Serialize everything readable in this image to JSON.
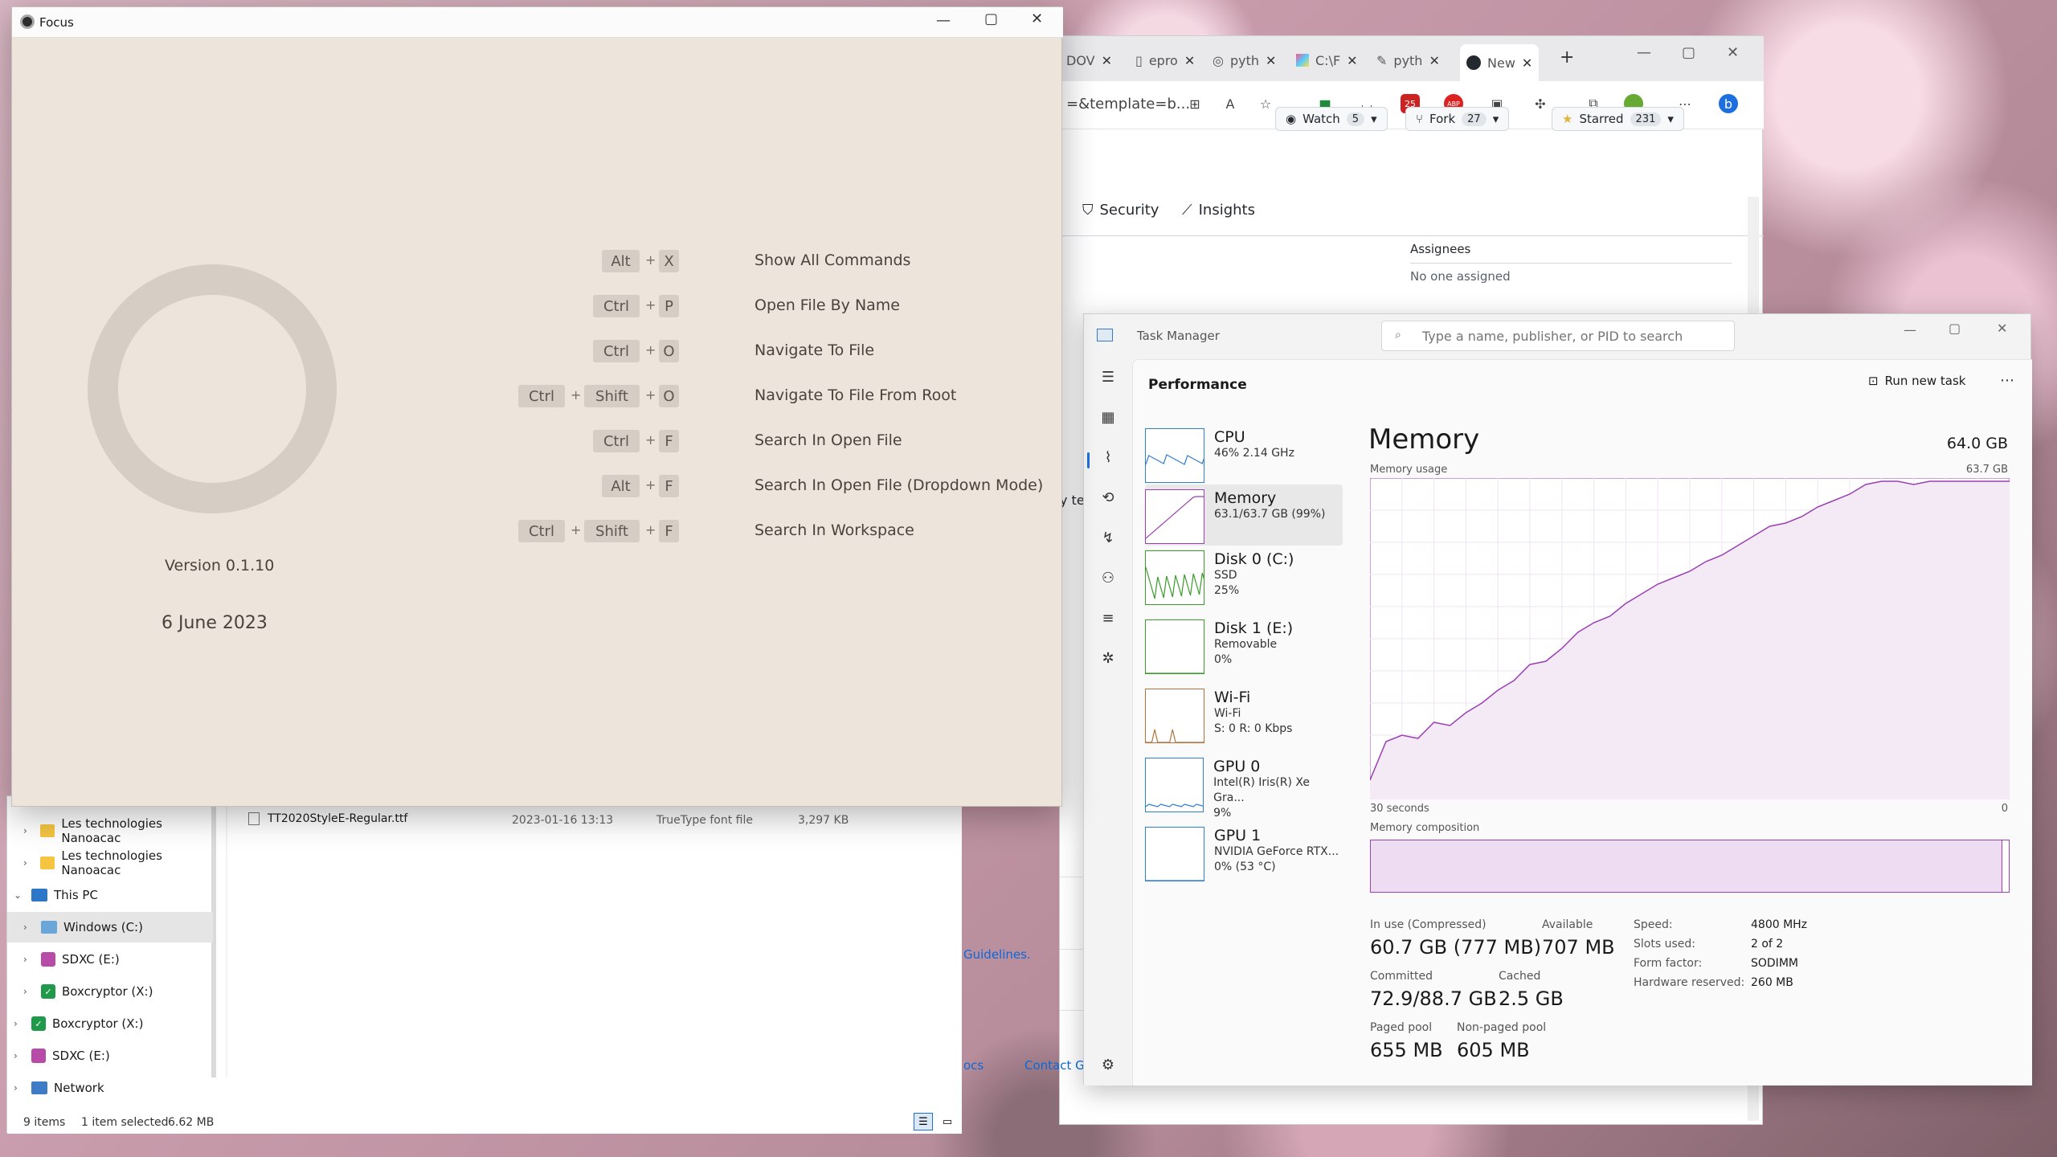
{
  "focus": {
    "title": "Focus",
    "version": "Version 0.1.10",
    "date": "6 June 2023",
    "commands": [
      {
        "keys": [
          "Alt",
          "X"
        ],
        "label": "Show All Commands"
      },
      {
        "keys": [
          "Ctrl",
          "P"
        ],
        "label": "Open File By Name"
      },
      {
        "keys": [
          "Ctrl",
          "O"
        ],
        "label": "Navigate To File"
      },
      {
        "keys": [
          "Ctrl",
          "Shift",
          "O"
        ],
        "label": "Navigate To File From Root"
      },
      {
        "keys": [
          "Ctrl",
          "F"
        ],
        "label": "Search In Open File"
      },
      {
        "keys": [
          "Alt",
          "F"
        ],
        "label": "Search In Open File (Dropdown Mode)"
      },
      {
        "keys": [
          "Ctrl",
          "Shift",
          "F"
        ],
        "label": "Search In Workspace"
      }
    ],
    "plus": "+"
  },
  "browser": {
    "tabs": [
      "DOV",
      "epro",
      "pyth",
      "C:\\F",
      "pyth",
      "New"
    ],
    "address": "=&template=b...",
    "repo_buttons": {
      "watch": "Watch",
      "watch_count": "5",
      "fork": "Fork",
      "fork_count": "27",
      "starred": "Starred",
      "starred_count": "231"
    },
    "nav": {
      "security": "Security",
      "insights": "Insights"
    },
    "assignees_label": "Assignees",
    "assignees_value": "No one assigned",
    "side_text": "y te:",
    "guidelines": "Guidelines.",
    "footer_docs": "ocs",
    "footer_contact": "Contact Git",
    "extension_badge": "25",
    "abp": "ABP"
  },
  "explorer": {
    "tree": [
      {
        "label": "Les technologies Nanoacac",
        "icon": "folder"
      },
      {
        "label": "Les technologies Nanoacac",
        "icon": "folder"
      },
      {
        "label": "This PC",
        "icon": "pc"
      },
      {
        "label": "Windows (C:)",
        "icon": "drive"
      },
      {
        "label": "SDXC (E:)",
        "icon": "sd"
      },
      {
        "label": "Boxcryptor (X:)",
        "icon": "green"
      },
      {
        "label": "Boxcryptor (X:)",
        "icon": "green"
      },
      {
        "label": "SDXC (E:)",
        "icon": "sd"
      },
      {
        "label": "Network",
        "icon": "network"
      }
    ],
    "file": {
      "name": "TT2020StyleE-Regular.ttf",
      "date": "2023-01-16 13:13",
      "type": "TrueType font file",
      "size": "3,297 KB"
    },
    "status": {
      "items": "9 items",
      "selected": "1 item selected",
      "size": "6.62 MB"
    }
  },
  "taskmgr": {
    "title": "Task Manager",
    "search_placeholder": "Type a name, publisher, or PID to search",
    "section": "Performance",
    "run_new_task": "Run new task",
    "list": [
      {
        "name": "CPU",
        "sub1": "46% 2.14 GHz",
        "sub2": "",
        "sub3": ""
      },
      {
        "name": "Memory",
        "sub1": "63.1/63.7 GB (99%)",
        "sub2": "",
        "sub3": ""
      },
      {
        "name": "Disk 0 (C:)",
        "sub1": "SSD",
        "sub2": "25%",
        "sub3": ""
      },
      {
        "name": "Disk 1 (E:)",
        "sub1": "Removable",
        "sub2": "0%",
        "sub3": ""
      },
      {
        "name": "Wi-Fi",
        "sub1": "Wi-Fi",
        "sub2": "S: 0 R: 0 Kbps",
        "sub3": ""
      },
      {
        "name": "GPU 0",
        "sub1": "Intel(R) Iris(R) Xe Gra...",
        "sub2": "9%",
        "sub3": ""
      },
      {
        "name": "GPU 1",
        "sub1": "NVIDIA GeForce RTX...",
        "sub2": "0% (53 °C)",
        "sub3": ""
      }
    ],
    "memory": {
      "heading": "Memory",
      "total": "64.0 GB",
      "usage_label": "Memory usage",
      "usage_max": "63.7 GB",
      "time_left": "30 seconds",
      "time_right": "0",
      "composition_label": "Memory composition",
      "in_use_label": "In use (Compressed)",
      "in_use": "60.7 GB (777 MB)",
      "available_label": "Available",
      "available": "707 MB",
      "committed_label": "Committed",
      "committed": "72.9/88.7 GB",
      "cached_label": "Cached",
      "cached": "2.5 GB",
      "paged_label": "Paged pool",
      "paged": "655 MB",
      "nonpaged_label": "Non-paged pool",
      "nonpaged": "605 MB",
      "specs": [
        {
          "label": "Speed:",
          "value": "4800 MHz"
        },
        {
          "label": "Slots used:",
          "value": "2 of 2"
        },
        {
          "label": "Form factor:",
          "value": "SODIMM"
        },
        {
          "label": "Hardware reserved:",
          "value": "260 MB"
        }
      ],
      "usage_series": [
        6,
        18,
        20,
        19,
        24,
        23,
        27,
        30,
        34,
        37,
        42,
        43,
        47,
        52,
        55,
        57,
        61,
        64,
        67,
        69,
        71,
        74,
        76,
        79,
        82,
        85,
        86,
        88,
        91,
        93,
        95,
        98,
        99,
        99,
        98,
        99,
        99,
        99,
        99,
        99,
        99
      ],
      "usage_pct": 99
    },
    "accent": "#9b3fb5"
  }
}
